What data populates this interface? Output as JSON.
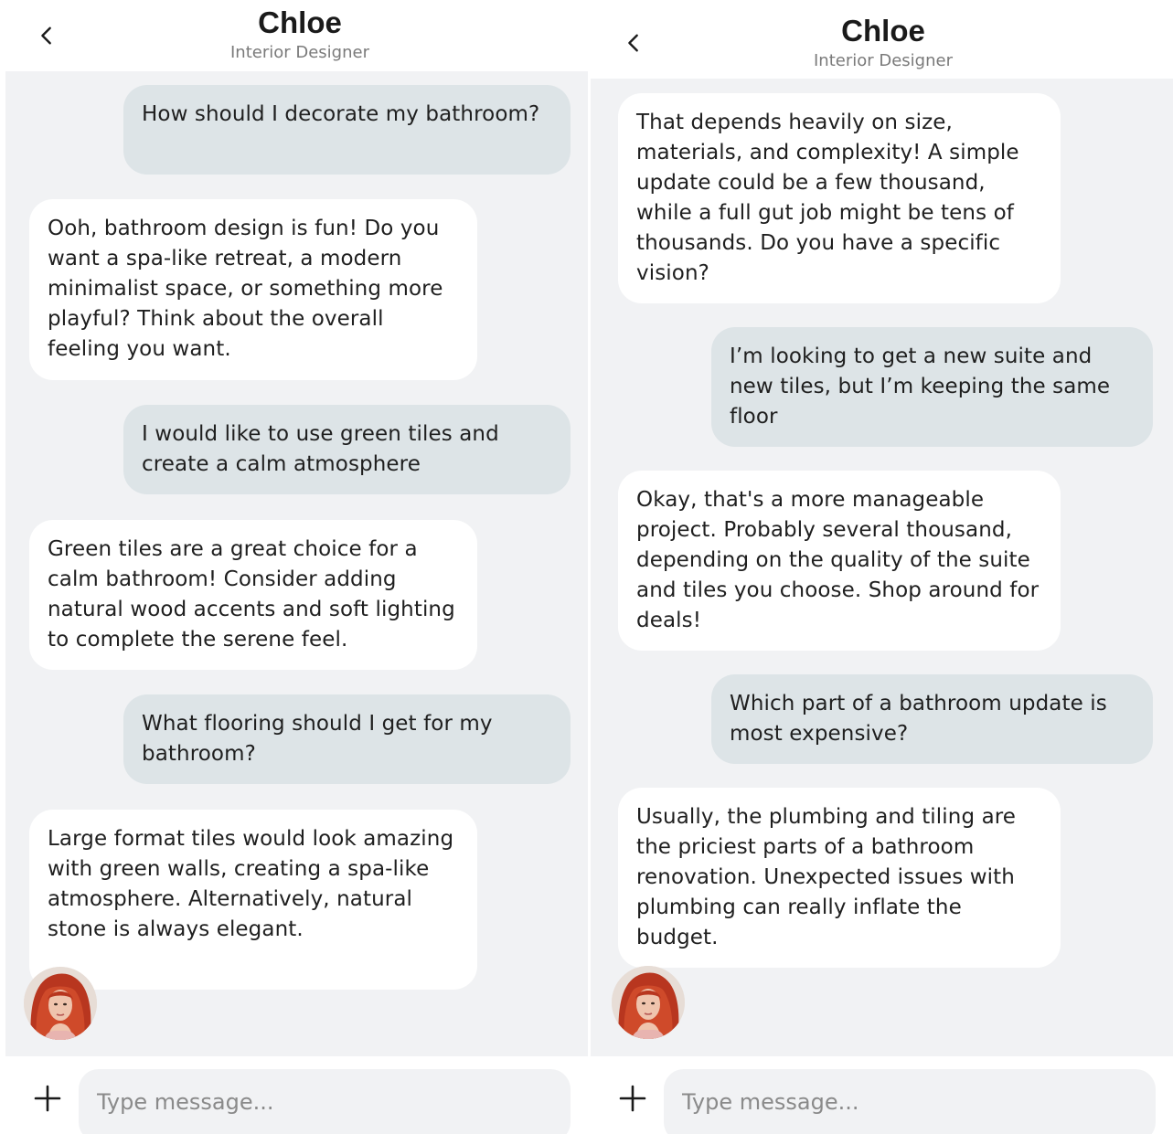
{
  "screens": [
    {
      "header": {
        "title": "Chloe",
        "subtitle": "Interior Designer",
        "back_icon": "chevron-left-icon"
      },
      "messages": [
        {
          "role": "user",
          "text": "How should I decorate my bathroom?"
        },
        {
          "role": "bot",
          "text": "Ooh, bathroom design is fun! Do you want a spa-like retreat, a modern minimalist space, or something more playful? Think about the overall feeling you want."
        },
        {
          "role": "user",
          "text": "I would like to use green tiles and create a calm atmosphere"
        },
        {
          "role": "bot",
          "text": "Green tiles are a great choice for a calm bathroom! Consider adding natural wood accents and soft lighting to complete the serene feel."
        },
        {
          "role": "user",
          "text": "What flooring should I get for my bathroom?"
        },
        {
          "role": "bot",
          "text": "Large format tiles would look amazing with green walls, creating a spa-like atmosphere. Alternatively, natural stone is always elegant."
        }
      ],
      "composer": {
        "placeholder": "Type message...",
        "add_icon": "plus-icon"
      }
    },
    {
      "header": {
        "title": "Chloe",
        "subtitle": "Interior Designer",
        "back_icon": "chevron-left-icon"
      },
      "messages": [
        {
          "role": "bot",
          "text": "That depends heavily on size, materials, and complexity! A simple update could be a few thousand, while a full gut job might be tens of thousands. Do you have a specific vision?"
        },
        {
          "role": "user",
          "text": "I’m looking to get a new suite and new tiles, but I’m keeping the same floor"
        },
        {
          "role": "bot",
          "text": "Okay, that's a more manageable project. Probably several thousand, depending on the quality of the suite and tiles you choose. Shop around for deals!"
        },
        {
          "role": "user",
          "text": "Which part of a bathroom update is most expensive?"
        },
        {
          "role": "bot",
          "text": "Usually, the plumbing and tiling are the priciest parts of a bathroom renovation. Unexpected issues with plumbing can really inflate the budget."
        }
      ],
      "composer": {
        "placeholder": "Type message...",
        "add_icon": "plus-icon"
      }
    }
  ],
  "colors": {
    "chat_background": "#f1f2f4",
    "user_bubble": "#dde4e7",
    "bot_bubble": "#ffffff",
    "subtitle_text": "#7a7a7a"
  }
}
